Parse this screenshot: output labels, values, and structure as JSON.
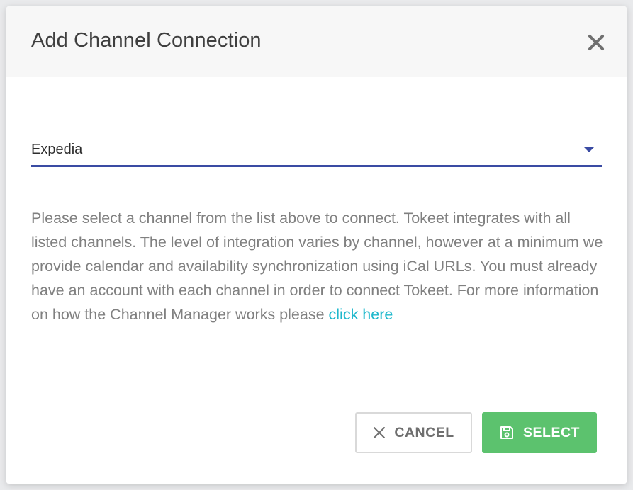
{
  "modal": {
    "title": "Add Channel Connection"
  },
  "channel_select": {
    "selected_value": "Expedia"
  },
  "description": {
    "text": "Please select a channel from the list above to connect. Tokeet integrates with all listed channels. The level of integration varies by channel, however at a minimum we provide calendar and availability synchronization using iCal URLs. You must already have an account with each channel in order to connect Tokeet. For more information on how the Channel Manager works please ",
    "link_text": "click here"
  },
  "buttons": {
    "cancel_label": "CANCEL",
    "select_label": "SELECT"
  },
  "colors": {
    "accent": "#3a4ba3",
    "link": "#1fb8cc",
    "success": "#5cc26e"
  },
  "icons": {
    "close": "close-icon",
    "dropdown": "chevron-down-icon",
    "cancel": "x-icon",
    "select": "save-icon"
  }
}
